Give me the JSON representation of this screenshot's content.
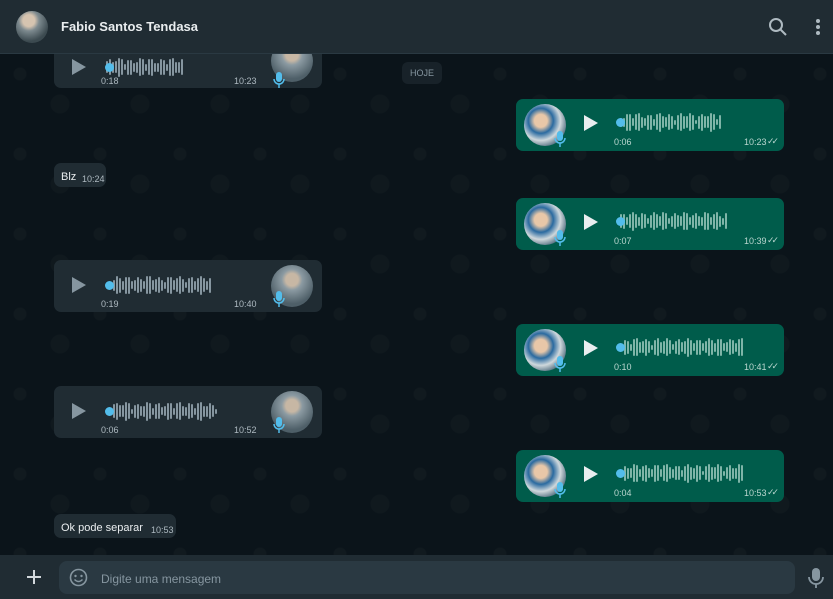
{
  "header": {
    "contact_name": "Fabio Santos Tendasa",
    "icons": [
      "search-icon",
      "menu-icon"
    ]
  },
  "day_badge": "HOJE",
  "messages": [
    {
      "type": "voice",
      "dir": "in",
      "duration": "0:18",
      "time": "10:23"
    },
    {
      "type": "voice",
      "dir": "out",
      "duration": "0:06",
      "time": "10:23",
      "status": "read"
    },
    {
      "type": "text",
      "dir": "in",
      "text": "Blz",
      "time": "10:24"
    },
    {
      "type": "voice",
      "dir": "out",
      "duration": "0:07",
      "time": "10:39",
      "status": "read"
    },
    {
      "type": "voice",
      "dir": "in",
      "duration": "0:19",
      "time": "10:40"
    },
    {
      "type": "voice",
      "dir": "out",
      "duration": "0:10",
      "time": "10:41",
      "status": "read"
    },
    {
      "type": "voice",
      "dir": "in",
      "duration": "0:06",
      "time": "10:52"
    },
    {
      "type": "voice",
      "dir": "out",
      "duration": "0:04",
      "time": "10:53",
      "status": "read"
    },
    {
      "type": "text",
      "dir": "in",
      "text": "Ok pode separar",
      "time": "10:53"
    }
  ],
  "composer": {
    "placeholder": "Digite uma mensagem",
    "icons": [
      "plus-icon",
      "sticker-icon",
      "mic-icon"
    ]
  },
  "colors": {
    "incoming": "#202c33",
    "outgoing": "#005c4b",
    "accent": "#53bdeb",
    "background": "#0b141a"
  }
}
